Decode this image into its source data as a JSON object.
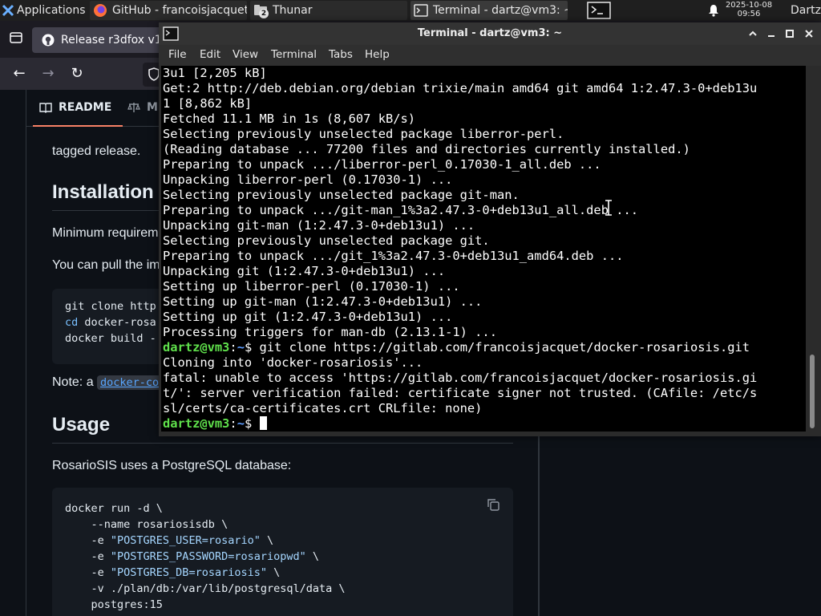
{
  "panel": {
    "applications_label": "Applications",
    "tasks": [
      {
        "label": "GitHub - francoisjacquet/…",
        "icon": "firefox-icon"
      },
      {
        "label": "Thunar",
        "icon": "folder-icon",
        "badge": "2"
      },
      {
        "label": "Terminal - dartz@vm3: ~",
        "icon": "terminal-icon"
      }
    ],
    "clock_date": "2025-10-08",
    "clock_time": "09:56",
    "user_label": "Dartz"
  },
  "browser": {
    "tab_title": "Release r3dfox v1",
    "readme_tab": "README",
    "second_tab": "M",
    "readme": {
      "line_tagged": "tagged release.",
      "h_installation": "Installation",
      "p_minimum": "Minimum requirem",
      "p_pull": "You can pull the im",
      "code1": [
        "git clone http",
        "cd docker-rosa",
        "docker build -"
      ],
      "code1_cd": "cd",
      "code1_rest": " docker-rosa",
      "note_prefix": "Note: a ",
      "note_code": "docker-co",
      "h_usage": "Usage",
      "p_usage": "RosarioSIS uses a PostgreSQL database:",
      "code2": {
        "l1": "docker run -d \\",
        "l2": "    --name rosariosisdb \\",
        "l3_pre": "    -e ",
        "l3_str": "\"POSTGRES_USER=rosario\"",
        "l3_post": " \\",
        "l4_pre": "    -e ",
        "l4_str": "\"POSTGRES_PASSWORD=rosariopwd\"",
        "l4_post": " \\",
        "l5_pre": "    -e ",
        "l5_str": "\"POSTGRES_DB=rosariosis\"",
        "l5_post": " \\",
        "l6": "    -v ./plan/db:/var/lib/postgresql/data \\",
        "l7": "    postgres:15"
      }
    }
  },
  "terminal": {
    "title": "Terminal - dartz@vm3: ~",
    "menu": [
      "File",
      "Edit",
      "View",
      "Terminal",
      "Tabs",
      "Help"
    ],
    "lines": [
      "3u1 [2,205 kB]",
      "Get:2 http://deb.debian.org/debian trixie/main amd64 git amd64 1:2.47.3-0+deb13u",
      "1 [8,862 kB]",
      "Fetched 11.1 MB in 1s (8,607 kB/s)",
      "Selecting previously unselected package liberror-perl.",
      "(Reading database ... 77200 files and directories currently installed.)",
      "Preparing to unpack .../liberror-perl_0.17030-1_all.deb ...",
      "Unpacking liberror-perl (0.17030-1) ...",
      "Selecting previously unselected package git-man.",
      "Preparing to unpack .../git-man_1%3a2.47.3-0+deb13u1_all.deb ...",
      "Unpacking git-man (1:2.47.3-0+deb13u1) ...",
      "Selecting previously unselected package git.",
      "Preparing to unpack .../git_1%3a2.47.3-0+deb13u1_amd64.deb ...",
      "Unpacking git (1:2.47.3-0+deb13u1) ...",
      "Setting up liberror-perl (0.17030-1) ...",
      "Setting up git-man (1:2.47.3-0+deb13u1) ...",
      "Setting up git (1:2.47.3-0+deb13u1) ...",
      "Processing triggers for man-db (2.13.1-1) ..."
    ],
    "prompt_user": "dartz@vm3",
    "prompt_sep": ":",
    "prompt_path": "~",
    "prompt_sign": "$ ",
    "command": "git clone https://gitlab.com/francoisjacquet/docker-rosariosis.git",
    "out_lines": [
      "Cloning into 'docker-rosariosis'...",
      "fatal: unable to access 'https://gitlab.com/francoisjacquet/docker-rosariosis.gi",
      "t/': server verification failed: certificate signer not trusted. (CAfile: /etc/s",
      "sl/certs/ca-certificates.crt CRLfile: none)"
    ]
  }
}
